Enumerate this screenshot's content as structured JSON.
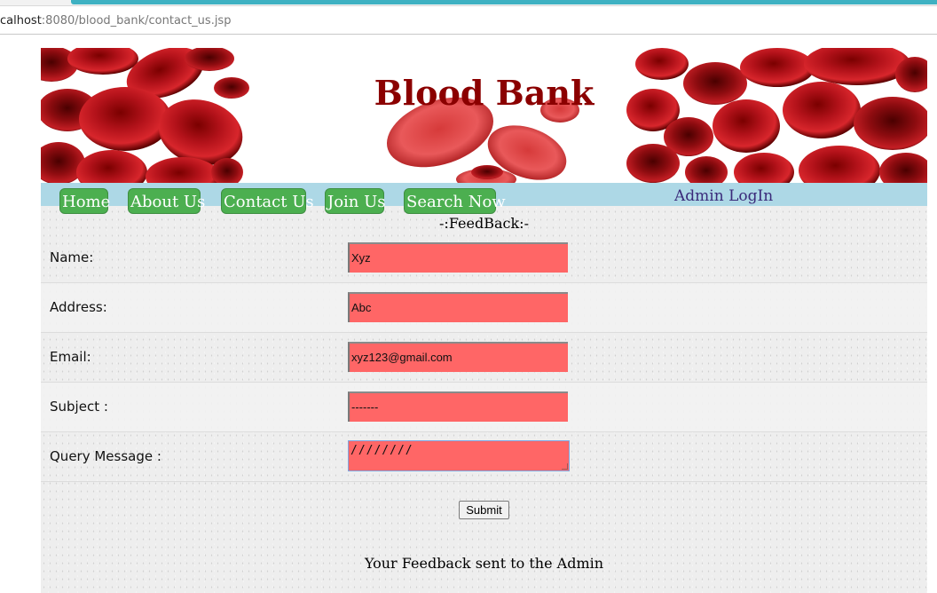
{
  "browser": {
    "url_host": "calhost",
    "url_rest": ":8080/blood_bank/contact_us.jsp"
  },
  "banner": {
    "title": "Blood Bank"
  },
  "nav": {
    "items": [
      {
        "label": "Home"
      },
      {
        "label": "About Us"
      },
      {
        "label": "Contact Us"
      },
      {
        "label": "Join Us"
      },
      {
        "label": "Search Now"
      }
    ],
    "admin_label": "Admin LogIn"
  },
  "form": {
    "heading": "-:FeedBack:-",
    "fields": [
      {
        "label": "Name:",
        "value": "Xyz"
      },
      {
        "label": "Address:",
        "value": "Abc"
      },
      {
        "label": "Email:",
        "value": "xyz123@gmail.com"
      },
      {
        "label": "Subject :",
        "value": "-------"
      },
      {
        "label": "Query Message :",
        "value": "////////"
      }
    ],
    "submit_label": "Submit",
    "status_message": "Your Feedback sent to the Admin"
  },
  "colors": {
    "field_bg": "#ff6666",
    "nav_bg": "#add8e6",
    "nav_button": "#4caf50",
    "title": "#8b0000"
  }
}
